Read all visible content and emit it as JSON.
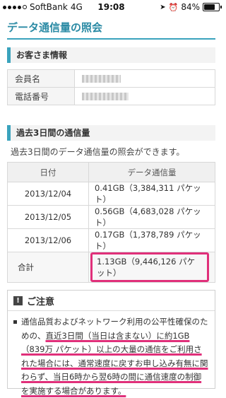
{
  "status_bar": {
    "carrier": "SoftBank",
    "network": "4G",
    "time": "19:08",
    "battery": "84%",
    "battery_level": 0.84
  },
  "page": {
    "title": "データ通信量の照会"
  },
  "customer_section": {
    "heading": "お客さま情報",
    "rows": [
      {
        "label": "会員名",
        "value": ""
      },
      {
        "label": "電話番号",
        "value": ""
      }
    ]
  },
  "usage_section": {
    "heading": "過去3日間の通信量",
    "intro": "過去3日間のデータ通信量の照会ができます。",
    "columns": [
      "日付",
      "データ通信量"
    ],
    "rows": [
      {
        "date": "2013/12/04",
        "amount": "0.41GB（3,384,311 パケット）"
      },
      {
        "date": "2013/12/05",
        "amount": "0.56GB（4,683,028 パケット）"
      },
      {
        "date": "2013/12/06",
        "amount": "0.17GB（1,378,789 パケット）"
      }
    ],
    "total": {
      "label": "合計",
      "amount": "1.13GB（9,446,126 パケット）"
    }
  },
  "notice": {
    "icon_label": "!",
    "heading": "ご注意",
    "text_part1": "通信品質およびネットワーク利用の公平性確保のための、",
    "text_part2": "直近3日間（当日は含まない）に約1GB（839万 パケット）以上の大量の通信をご利用された場合には、通常速度に戻すお申し込み有無に関わらず、当日6時から翌6時の間に通信速度の制御を実施する場合があります。"
  },
  "colors": {
    "accent": "#3aa3bd",
    "title": "#2a8aa4",
    "highlight": "#e0307a"
  }
}
